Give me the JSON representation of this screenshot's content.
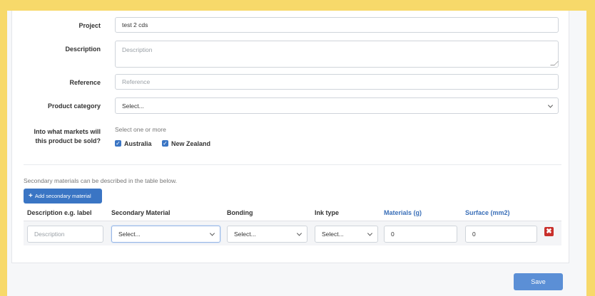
{
  "form": {
    "project": {
      "label": "Project",
      "value": "test 2 cds"
    },
    "description": {
      "label": "Description",
      "placeholder": "Description"
    },
    "reference": {
      "label": "Reference",
      "placeholder": "Reference"
    },
    "product_category": {
      "label": "Product category",
      "selected": "Select..."
    },
    "markets": {
      "label_line1": "Into what markets will",
      "label_line2": "this product be sold?",
      "hint": "Select one or more",
      "options": [
        {
          "label": "Australia",
          "checked": true
        },
        {
          "label": "New Zealand",
          "checked": true
        }
      ]
    }
  },
  "secondary": {
    "intro": "Secondary materials can be described in the table below.",
    "add_button": "Add secondary material",
    "headers": {
      "description": "Description e.g. label",
      "material": "Secondary Material",
      "bonding": "Bonding",
      "ink_type": "Ink type",
      "materials_g": "Materials (g)",
      "surface": "Surface (mm2)"
    },
    "row": {
      "description_placeholder": "Description",
      "material": "Select...",
      "bonding": "Select...",
      "ink_type": "Select...",
      "materials_g": "0",
      "surface": "0",
      "delete_glyph": "✖"
    }
  },
  "actions": {
    "save": "Save"
  },
  "colors": {
    "accent": "#3a75c4",
    "save": "#5b8fd6",
    "danger": "#c9302c",
    "frame": "#f7d96a"
  }
}
